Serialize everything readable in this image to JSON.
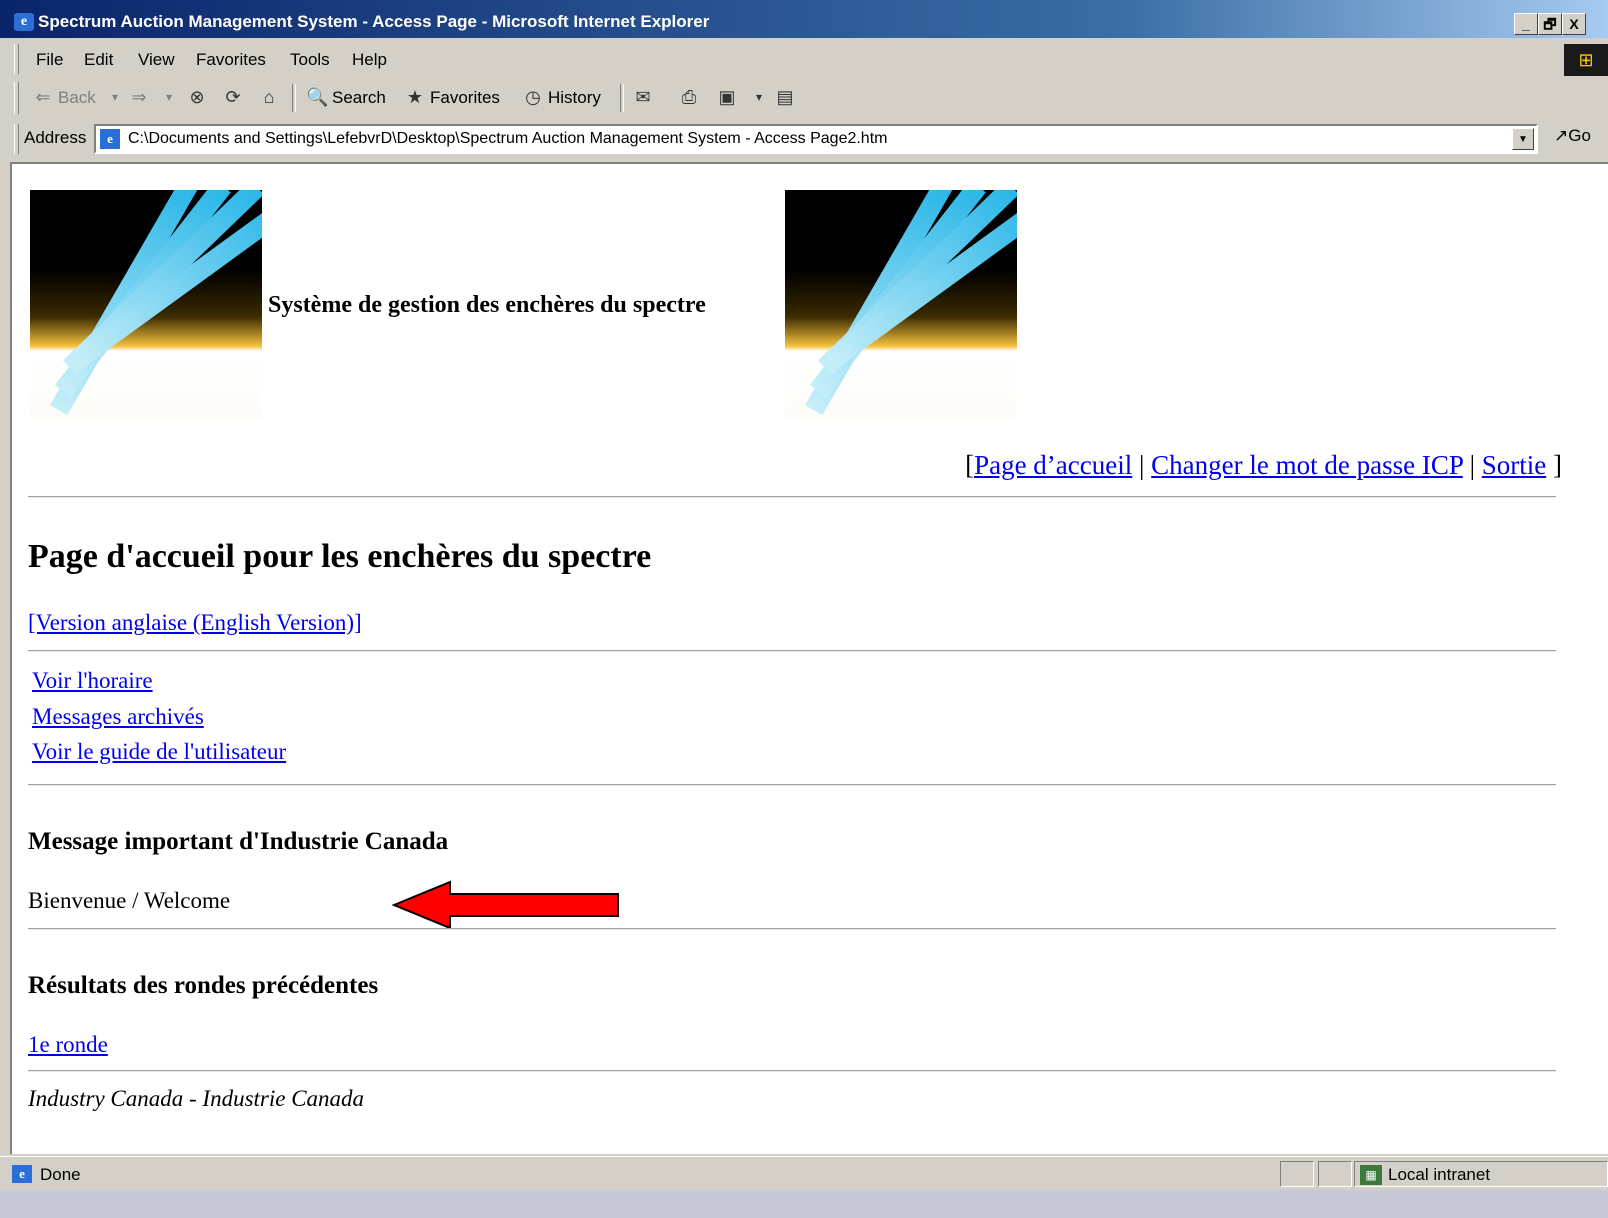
{
  "window": {
    "title": "Spectrum Auction Management System - Access Page - Microsoft Internet Explorer",
    "minimize": "_",
    "restore": "🗗",
    "close": "X"
  },
  "menu": [
    "File",
    "Edit",
    "View",
    "Favorites",
    "Tools",
    "Help"
  ],
  "toolbar": {
    "back": "Back",
    "search": "Search",
    "favorites": "Favorites",
    "history": "History"
  },
  "address": {
    "label": "Address",
    "value": "C:\\Documents and Settings\\LefebvrD\\Desktop\\Spectrum Auction Management System - Access Page2.htm",
    "go": "Go"
  },
  "page": {
    "banner_title": "Système de gestion des enchères du spectre",
    "nav": {
      "open": "[",
      "sep": " | ",
      "close": " ]",
      "links": [
        "Page d’accueil",
        "Changer le mot de passe ICP",
        "Sortie"
      ]
    },
    "heading": "Page d'accueil pour les enchères du spectre",
    "english_link": "[Version anglaise (English Version)]",
    "links": [
      "Voir l'horaire",
      "Messages archivés",
      "Voir le guide de l'utilisateur"
    ],
    "message_heading": "Message important d'Industrie Canada",
    "message": "Bienvenue / Welcome",
    "results_heading": "Résultats des rondes précédentes",
    "round_link": "1e ronde",
    "footer": "Industry Canada - Industrie Canada"
  },
  "status": {
    "text": "Done",
    "zone": "Local intranet"
  },
  "colors": {
    "link": "#0000ee",
    "arrow": "#ff0000",
    "titlebar": "#0a246a"
  }
}
